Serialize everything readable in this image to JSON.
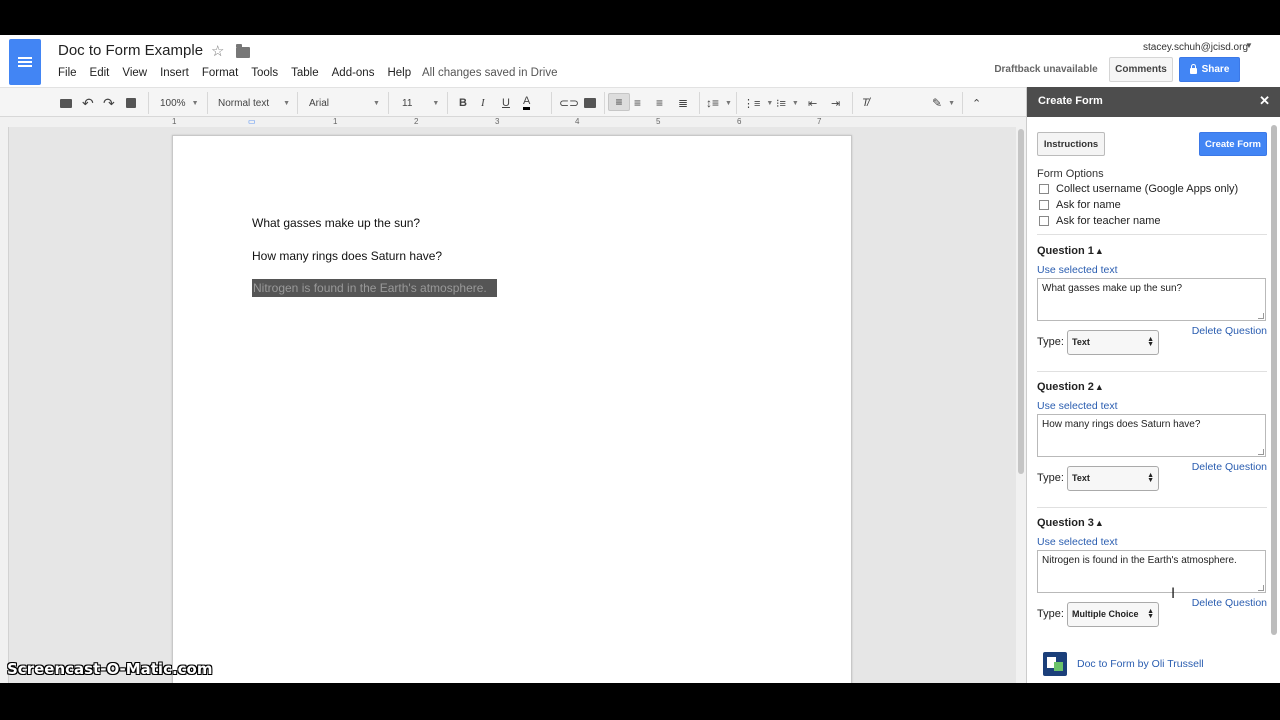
{
  "doc": {
    "title": "Doc to Form Example",
    "save_status": "All changes saved in Drive",
    "paragraphs": [
      "What gasses make up the sun?",
      "How many rings does Saturn have?",
      "Nitrogen is found in the Earth's atmosphere."
    ]
  },
  "menu": [
    "File",
    "Edit",
    "View",
    "Insert",
    "Format",
    "Tools",
    "Table",
    "Add-ons",
    "Help"
  ],
  "account": {
    "email": "stacey.schuh@jcisd.org"
  },
  "header_buttons": {
    "draftback": "Draftback unavailable",
    "comments": "Comments",
    "share": "Share"
  },
  "toolbar": {
    "zoom": "100%",
    "style": "Normal text",
    "font": "Arial",
    "size": "11"
  },
  "ruler": [
    "1",
    "1",
    "2",
    "3",
    "4",
    "5",
    "6",
    "7"
  ],
  "sidebar": {
    "title": "Create Form",
    "instructions_button": "Instructions",
    "create_button": "Create Form",
    "options_label": "Form Options",
    "options": [
      "Collect username (Google Apps only)",
      "Ask for name",
      "Ask for teacher name"
    ],
    "use_selected": "Use selected text",
    "type_label": "Type:",
    "delete_label": "Delete Question",
    "questions": [
      {
        "title": "Question 1",
        "text": "What gasses make up the sun?",
        "type": "Text"
      },
      {
        "title": "Question 2",
        "text": "How many rings does Saturn have?",
        "type": "Text"
      },
      {
        "title": "Question 3",
        "text": "Nitrogen is found in the Earth's atmosphere.",
        "type": "Multiple Choice"
      }
    ],
    "credit": "Doc to Form by Oli Trussell"
  },
  "watermark": "Screencast-O-Matic.com",
  "colors": {
    "accent_blue": "#4285f4",
    "link_blue": "#2a5db0",
    "sidebar_header": "#4d4d4d"
  }
}
